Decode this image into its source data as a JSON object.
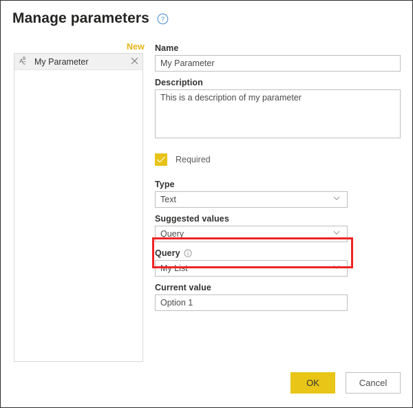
{
  "dialog": {
    "title": "Manage parameters",
    "help_icon": "help-circle-icon"
  },
  "list_panel": {
    "new_label": "New",
    "items": [
      {
        "type_icon": "abc-text-type-icon",
        "label": "My Parameter",
        "remove_icon": "close-x-icon"
      }
    ]
  },
  "form": {
    "name": {
      "label": "Name",
      "value": "My Parameter",
      "placeholder": ""
    },
    "description": {
      "label": "Description",
      "value": "This is a description of my parameter",
      "placeholder": ""
    },
    "required": {
      "label": "Required",
      "checked": true,
      "check_icon": "checkmark-icon"
    },
    "type": {
      "label": "Type",
      "value": "Text",
      "chevron_icon": "chevron-down-icon"
    },
    "suggested_values": {
      "label": "Suggested values",
      "value": "Query",
      "chevron_icon": "chevron-down-icon"
    },
    "query": {
      "label": "Query",
      "info_icon": "info-circle-icon",
      "value": "My List",
      "chevron_icon": "chevron-down-icon"
    },
    "current_value": {
      "label": "Current value",
      "value": "Option 1",
      "placeholder": ""
    }
  },
  "footer": {
    "ok_label": "OK",
    "cancel_label": "Cancel"
  },
  "colors": {
    "accent_gold": "#e8c517",
    "new_link_gold": "#e8b317",
    "highlight_red": "#ee2424",
    "help_blue": "#4a90d9",
    "border_gray": "#bfbfbf"
  }
}
